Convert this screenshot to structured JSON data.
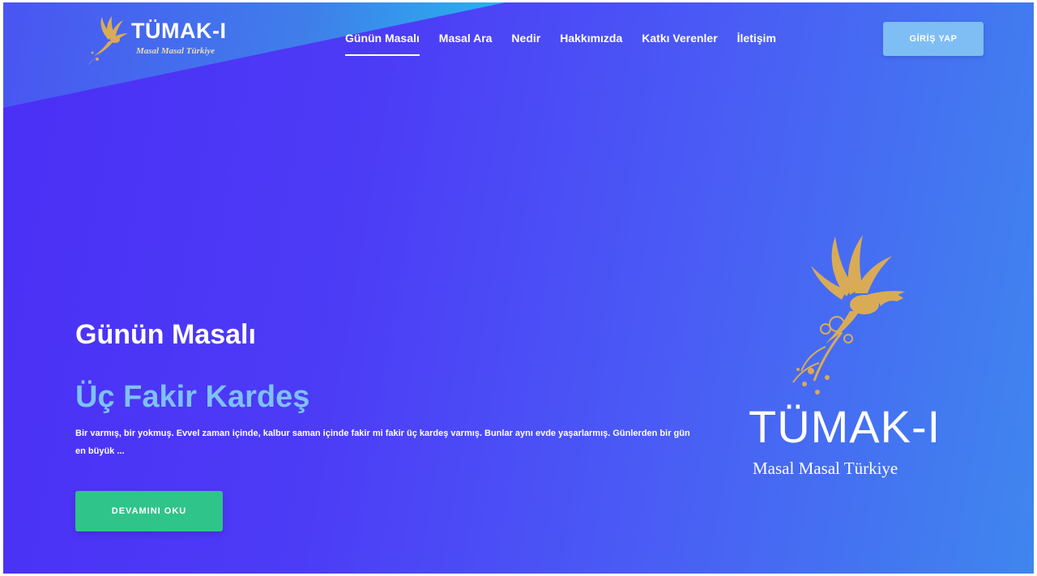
{
  "header": {
    "logo_title": "TÜMAK-I",
    "logo_subtitle": "Masal Masal Türkiye",
    "nav": [
      {
        "label": "Günün Masalı",
        "active": true
      },
      {
        "label": "Masal Ara",
        "active": false
      },
      {
        "label": "Nedir",
        "active": false
      },
      {
        "label": "Hakkımızda",
        "active": false
      },
      {
        "label": "Katkı Verenler",
        "active": false
      },
      {
        "label": "İletişim",
        "active": false
      }
    ],
    "login_label": "GİRİŞ YAP"
  },
  "hero": {
    "section_label": "Günün Masalı",
    "story_title": "Üç Fakir Kardeş",
    "excerpt": "Bir varmış, bir yokmuş. Evvel zaman içinde, kalbur saman içinde fakir mi fakir üç kardeş varmış. Bunlar aynı evde yaşarlarmış. Günlerden bir gün en büyük ...",
    "read_more_label": "DEVAMINI OKU"
  },
  "brand_panel": {
    "title": "TÜMAK-I",
    "subtitle": "Masal Masal Türkiye"
  },
  "colors": {
    "accent_gold": "#d9ab57",
    "title_blue": "#7ec1f8",
    "button_green": "#2fc48a",
    "login_blue": "#7fbdf5"
  },
  "icons": {
    "logo": "phoenix-bird-icon"
  }
}
